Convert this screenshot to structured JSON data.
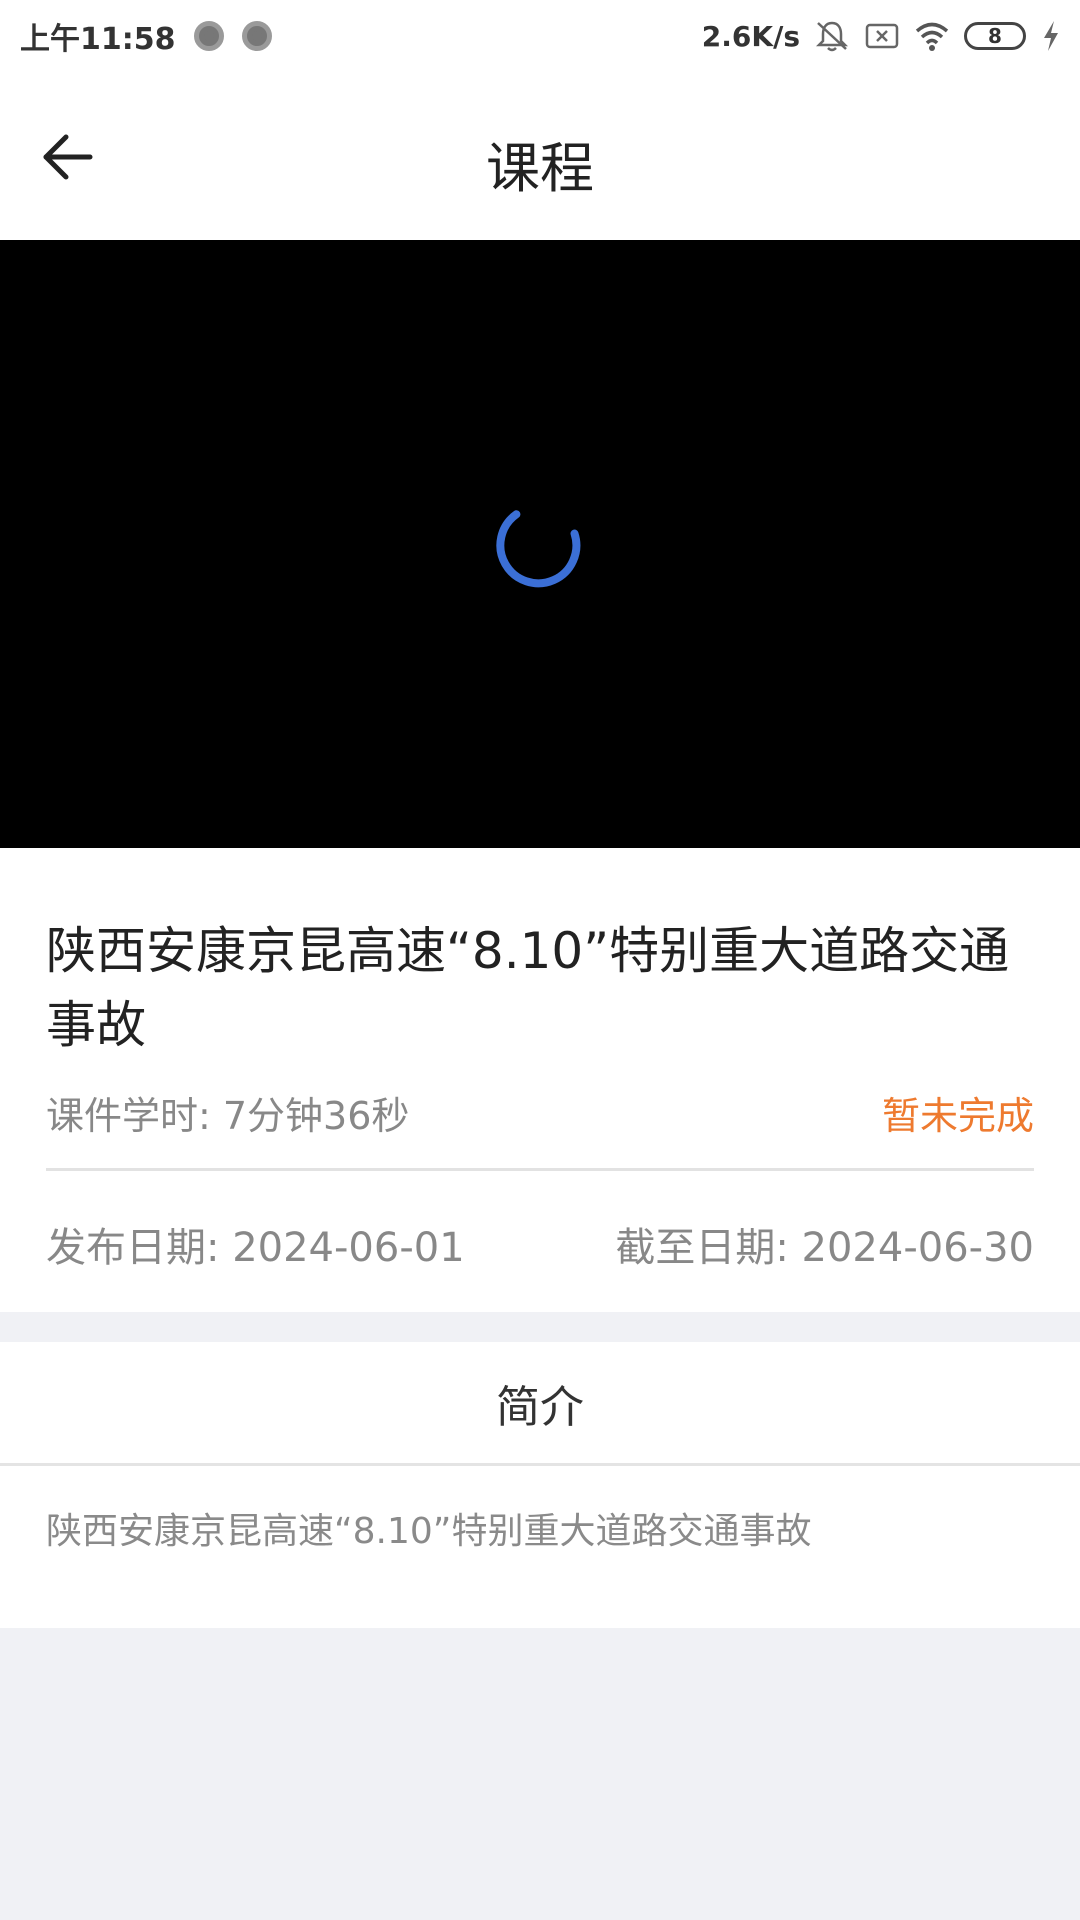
{
  "status_bar": {
    "time": "上午11:58",
    "net_speed": "2.6K/s",
    "battery": "8"
  },
  "header": {
    "title": "课程"
  },
  "video": {
    "spinner_color": "#3b6fd6"
  },
  "course": {
    "title": "陕西安康京昆高速“8.10”特别重大道路交通事故",
    "duration": "课件学时: 7分钟36秒",
    "status": "暂未完成",
    "publish_date": "发布日期: 2024-06-01",
    "deadline": "截至日期: 2024-06-30"
  },
  "intro": {
    "tab_label": "简介",
    "text": "陕西安康京昆高速“8.10”特别重大道路交通事故"
  },
  "colors": {
    "accent_orange": "#ee7a2f",
    "text_primary": "#222222",
    "text_secondary": "#888888",
    "background": "#f0f1f5"
  }
}
